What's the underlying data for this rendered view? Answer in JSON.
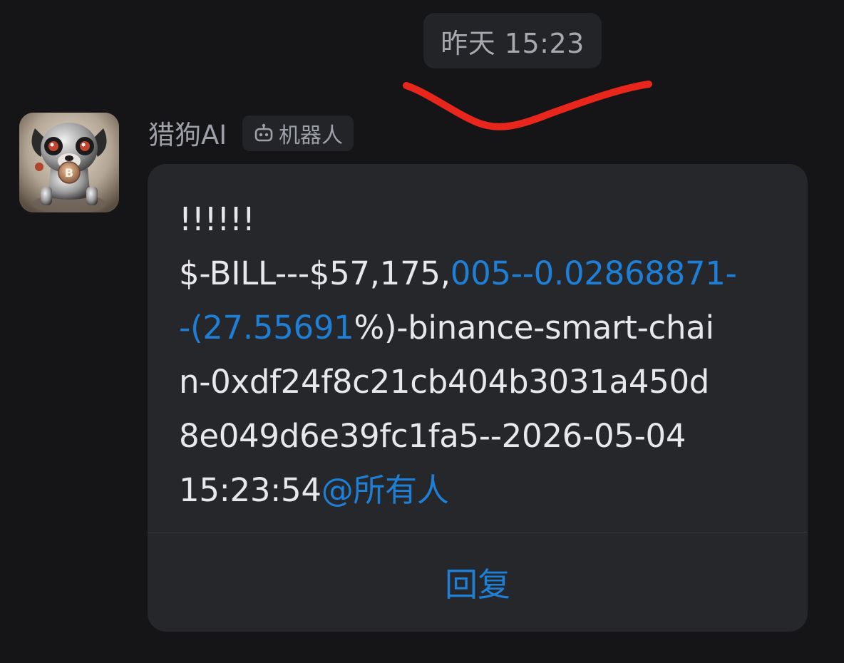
{
  "chat": {
    "timestamp": "昨天 15:23",
    "annotation_color": "#e8261c"
  },
  "message": {
    "sender": "猎狗AI",
    "badge": {
      "icon": "robot-icon",
      "label": "机器人"
    },
    "avatar": "robot-dog-avatar",
    "lines": [
      [
        {
          "text": "!!!!!!",
          "link": false
        }
      ],
      [
        {
          "text": "$-BILL---$57,175,",
          "link": false
        },
        {
          "text": "005--0.02868871-",
          "link": true
        }
      ],
      [
        {
          "text": "-(27.55691",
          "link": true
        },
        {
          "text": "%)-binance-smart-chai",
          "link": false
        }
      ],
      [
        {
          "text": "n-0xdf24f8c21cb404b3031a450d",
          "link": false
        }
      ],
      [
        {
          "text": "8e049d6e39fc1fa5--2026-05-04",
          "link": false
        }
      ],
      [
        {
          "text": "15:23:54",
          "link": false
        },
        {
          "text": "@所有人",
          "link": true
        }
      ]
    ],
    "reply_label": "回复"
  },
  "colors": {
    "background": "#151517",
    "bubble": "#26272b",
    "link": "#1e7fd6",
    "text": "#e8e8ea"
  }
}
